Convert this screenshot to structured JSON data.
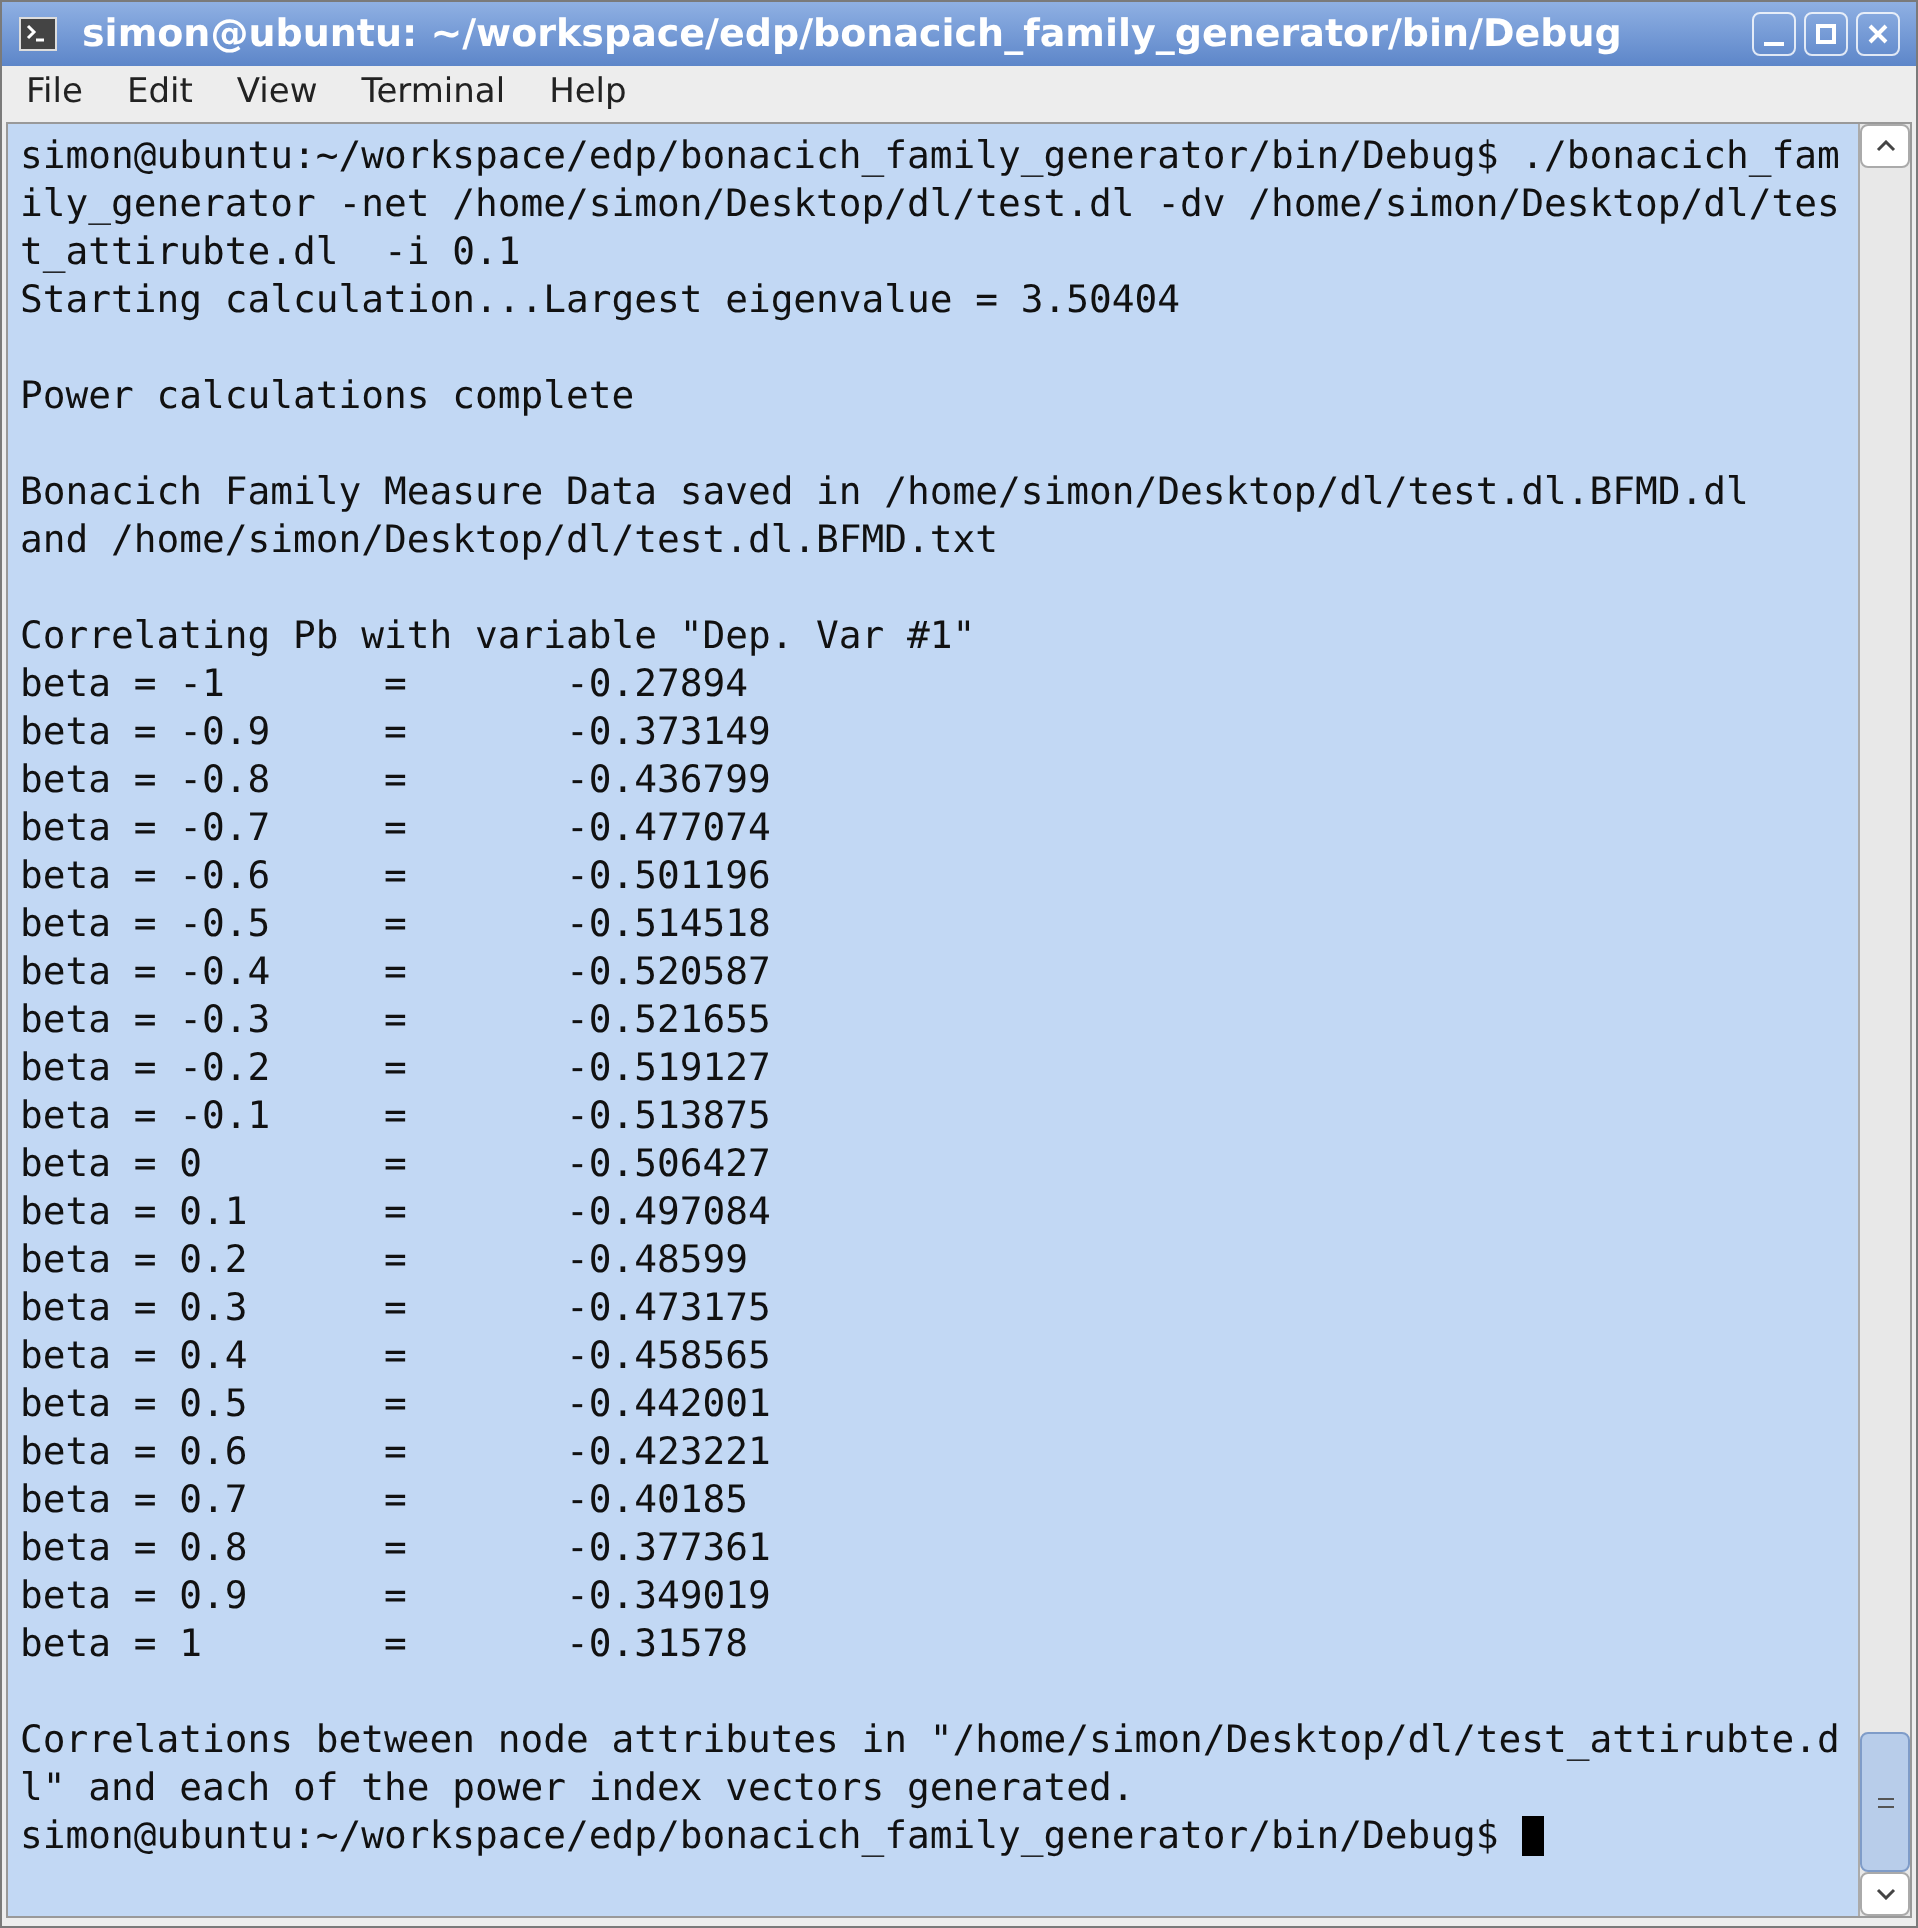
{
  "window": {
    "title": "simon@ubuntu: ~/workspace/edp/bonacich_family_generator/bin/Debug"
  },
  "menu": [
    "File",
    "Edit",
    "View",
    "Terminal",
    "Help"
  ],
  "terminal": {
    "lines": [
      {
        "kind": "text",
        "text": "simon@ubuntu:~/workspace/edp/bonacich_family_generator/bin/Debug$ ./bonacich_fam"
      },
      {
        "kind": "text",
        "text": "ily_generator -net /home/simon/Desktop/dl/test.dl -dv /home/simon/Desktop/dl/tes"
      },
      {
        "kind": "text",
        "text": "t_attirubte.dl  -i 0.1"
      },
      {
        "kind": "text",
        "text": "Starting calculation...Largest eigenvalue = 3.50404"
      },
      {
        "kind": "blank"
      },
      {
        "kind": "text",
        "text": "Power calculations complete"
      },
      {
        "kind": "blank"
      },
      {
        "kind": "text",
        "text": "Bonacich Family Measure Data saved in /home/simon/Desktop/dl/test.dl.BFMD.dl"
      },
      {
        "kind": "text",
        "text": "and /home/simon/Desktop/dl/test.dl.BFMD.txt"
      },
      {
        "kind": "blank"
      },
      {
        "kind": "text",
        "text": "Correlating Pb with variable \"Dep. Var #1\""
      },
      {
        "kind": "row",
        "cells": [
          "beta = -1",
          "=",
          "-0.27894"
        ]
      },
      {
        "kind": "row",
        "cells": [
          "beta = -0.9",
          "=",
          "-0.373149"
        ]
      },
      {
        "kind": "row",
        "cells": [
          "beta = -0.8",
          "=",
          "-0.436799"
        ]
      },
      {
        "kind": "row",
        "cells": [
          "beta = -0.7",
          "=",
          "-0.477074"
        ]
      },
      {
        "kind": "row",
        "cells": [
          "beta = -0.6",
          "=",
          "-0.501196"
        ]
      },
      {
        "kind": "row",
        "cells": [
          "beta = -0.5",
          "=",
          "-0.514518"
        ]
      },
      {
        "kind": "row",
        "cells": [
          "beta = -0.4",
          "=",
          "-0.520587"
        ]
      },
      {
        "kind": "row",
        "cells": [
          "beta = -0.3",
          "=",
          "-0.521655"
        ]
      },
      {
        "kind": "row",
        "cells": [
          "beta = -0.2",
          "=",
          "-0.519127"
        ]
      },
      {
        "kind": "row",
        "cells": [
          "beta = -0.1",
          "=",
          "-0.513875"
        ]
      },
      {
        "kind": "row",
        "cells": [
          "beta = 0",
          "=",
          "-0.506427"
        ]
      },
      {
        "kind": "row",
        "cells": [
          "beta = 0.1",
          "=",
          "-0.497084"
        ]
      },
      {
        "kind": "row",
        "cells": [
          "beta = 0.2",
          "=",
          "-0.48599"
        ]
      },
      {
        "kind": "row",
        "cells": [
          "beta = 0.3",
          "=",
          "-0.473175"
        ]
      },
      {
        "kind": "row",
        "cells": [
          "beta = 0.4",
          "=",
          "-0.458565"
        ]
      },
      {
        "kind": "row",
        "cells": [
          "beta = 0.5",
          "=",
          "-0.442001"
        ]
      },
      {
        "kind": "row",
        "cells": [
          "beta = 0.6",
          "=",
          "-0.423221"
        ]
      },
      {
        "kind": "row",
        "cells": [
          "beta = 0.7",
          "=",
          "-0.40185"
        ]
      },
      {
        "kind": "row",
        "cells": [
          "beta = 0.8",
          "=",
          "-0.377361"
        ]
      },
      {
        "kind": "row",
        "cells": [
          "beta = 0.9",
          "=",
          "-0.349019"
        ]
      },
      {
        "kind": "row",
        "cells": [
          "beta = 1",
          "=",
          "-0.31578"
        ]
      },
      {
        "kind": "blank"
      },
      {
        "kind": "text",
        "text": "Correlations between node attributes in \"/home/simon/Desktop/dl/test_attirubte.d"
      },
      {
        "kind": "text",
        "text": "l\" and each of the power index vectors generated."
      },
      {
        "kind": "prompt",
        "text": "simon@ubuntu:~/workspace/edp/bonacich_family_generator/bin/Debug$"
      }
    ]
  }
}
